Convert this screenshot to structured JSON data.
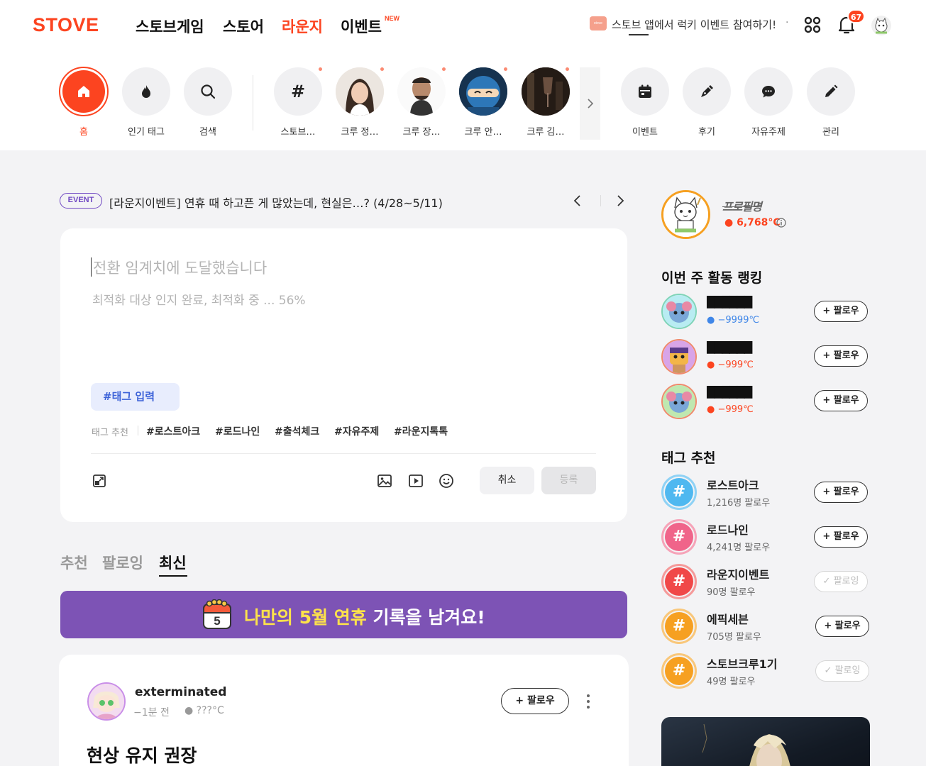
{
  "header": {
    "logo": "STOVE",
    "nav": [
      {
        "label": "스토브게임",
        "active": false
      },
      {
        "label": "스토어",
        "active": false
      },
      {
        "label": "라운지",
        "active": true
      },
      {
        "label": "이벤트",
        "active": false
      }
    ],
    "new_badge": "NEW",
    "promo_icon_text": "stove",
    "promo_text": "스토브 앱에서 럭키 이벤트 참여하기!",
    "promo_dot": "·",
    "notification_count": "67",
    "icons": [
      "apps-icon",
      "bell-icon",
      "avatar"
    ]
  },
  "shortcuts": {
    "main": [
      {
        "label": "홈",
        "icon": "home-icon",
        "active": true
      },
      {
        "label": "인기 태그",
        "icon": "flame-icon"
      },
      {
        "label": "검색",
        "icon": "search-icon"
      }
    ],
    "crews": [
      {
        "label": "스토브…",
        "icon": "hash-icon"
      },
      {
        "label": "크루 정…"
      },
      {
        "label": "크루 장…"
      },
      {
        "label": "크루 안…"
      },
      {
        "label": "크루 김…"
      }
    ],
    "more_icon": "chevron-right-icon",
    "tools": [
      {
        "label": "이벤트",
        "icon": "calendar-icon"
      },
      {
        "label": "후기",
        "icon": "pen-icon"
      },
      {
        "label": "자유주제",
        "icon": "chat-icon"
      },
      {
        "label": "관리",
        "icon": "pencil-icon"
      }
    ]
  },
  "event": {
    "badge": "EVENT",
    "text": "[라운지이벤트] 연휴 때 하고픈 게 많았는데, 현실은…? (4/28~5/11)"
  },
  "composer": {
    "title_placeholder": "전환 임계치에 도달했습니다",
    "body_placeholder": "최적화 대상 인지 완료, 최적화 중 ... 56%",
    "tag_input": "#태그 입력",
    "tag_rec_label": "태그 추천",
    "tag_suggestions": [
      "#로스트아크",
      "#로드나인",
      "#출석체크",
      "#자유주제",
      "#라운지톡톡"
    ],
    "cancel_label": "취소",
    "submit_label": "등록"
  },
  "feed_tabs": [
    {
      "label": "추천",
      "active": false
    },
    {
      "label": "팔로잉",
      "active": false
    },
    {
      "label": "최신",
      "active": true
    }
  ],
  "banner": {
    "calendar_day": "5",
    "highlight": "나만의 5월 연휴",
    "rest": " 기록을 남겨요!"
  },
  "post": {
    "author": "exterminated",
    "time": "−1분 전",
    "temperature": "???°C",
    "follow_label": "+ 팔로우",
    "title": "현상 유지 권장"
  },
  "profile": {
    "name": "프로필명",
    "temperature": "6,768°C"
  },
  "ranking": {
    "title": "이번 주 활동 랭킹",
    "items": [
      {
        "name": "██████",
        "temp": "−9999℃",
        "temp_color": "#3f86e8",
        "follow": "+ 팔로우"
      },
      {
        "name": "██████",
        "temp": "−999℃",
        "temp_color": "#fc4420",
        "follow": "+ 팔로우"
      },
      {
        "name": "██████",
        "temp": "−999℃",
        "temp_color": "#fc4420",
        "follow": "+ 팔로우"
      }
    ]
  },
  "tag_recommend": {
    "title": "태그 추천",
    "items": [
      {
        "name": "로스트아크",
        "followers": "1,216명 팔로우",
        "color": "#4fb8f0",
        "follow": "+ 팔로우",
        "following": false
      },
      {
        "name": "로드나인",
        "followers": "4,241명 팔로우",
        "color": "#f0648a",
        "follow": "+ 팔로우",
        "following": false
      },
      {
        "name": "라운지이벤트",
        "followers": "90명 팔로우",
        "color": "#f04848",
        "follow": "✓ 팔로잉",
        "following": true
      },
      {
        "name": "에픽세븐",
        "followers": "705명 팔로우",
        "color": "#f6a021",
        "follow": "+ 팔로우",
        "following": false
      },
      {
        "name": "스토브크루1기",
        "followers": "49명 팔로우",
        "color": "#f6a021",
        "follow": "✓ 팔로잉",
        "following": true
      }
    ]
  },
  "colors": {
    "brand": "#fc4420",
    "banner_bg": "#7d53b5",
    "banner_highlight": "#fde24b",
    "event_badge": "#6f47c2",
    "tag_input_text": "#3d63d8"
  }
}
